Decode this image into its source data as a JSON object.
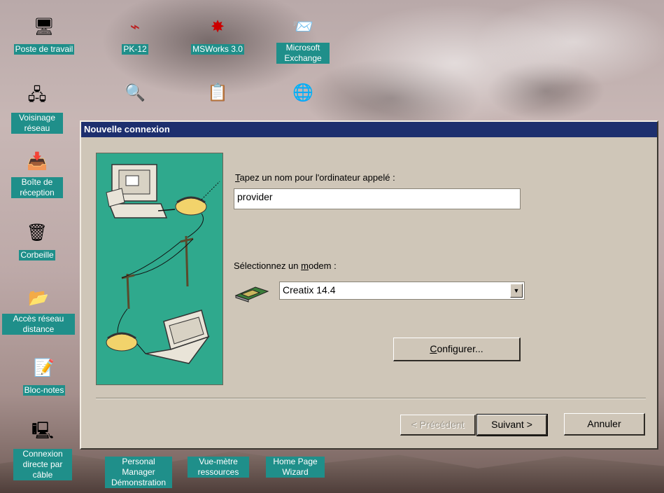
{
  "desktop": {
    "icons": [
      {
        "label": "Poste de travail",
        "glyph": "🖥"
      },
      {
        "label": "PK-12",
        "glyph": "⌁"
      },
      {
        "label": "MSWorks 3.0",
        "glyph": "✸"
      },
      {
        "label": "Microsoft Exchange",
        "glyph": "📨"
      },
      {
        "label": "Voisinage réseau",
        "glyph": "🖧"
      },
      {
        "label": "Boîte de réception",
        "glyph": "📥"
      },
      {
        "label": "Corbeille",
        "glyph": "🗑"
      },
      {
        "label": "Accès réseau distance",
        "glyph": "📂"
      },
      {
        "label": "Bloc-notes",
        "glyph": "📝"
      },
      {
        "label": "Connexion directe par câble",
        "glyph": "🖳"
      },
      {
        "label": "Personal Manager Démonstration",
        "glyph": ""
      },
      {
        "label": "Vue-mètre ressources",
        "glyph": ""
      },
      {
        "label": "Home Page Wizard",
        "glyph": ""
      },
      {
        "label": "",
        "glyph": "🔍"
      },
      {
        "label": "",
        "glyph": "📋"
      },
      {
        "label": "",
        "glyph": "🌐"
      }
    ]
  },
  "dialog": {
    "title": "Nouvelle connexion",
    "name_label_accel": "T",
    "name_label_rest": "apez un nom pour l'ordinateur appelé :",
    "name_value": "provider",
    "modem_label_pre": "Sélectionnez un ",
    "modem_label_accel": "m",
    "modem_label_rest": "odem :",
    "modem_selected": "Creatix 14.4",
    "configure_accel": "C",
    "configure_rest": "onfigurer...",
    "back_label": "< Précédent",
    "next_label": "Suivant >",
    "cancel_label": "Annuler"
  },
  "colors": {
    "titlebar": "#1d2f6e",
    "illustration_bg": "#2fa98d",
    "icon_label_bg": "#1f8f8a"
  }
}
